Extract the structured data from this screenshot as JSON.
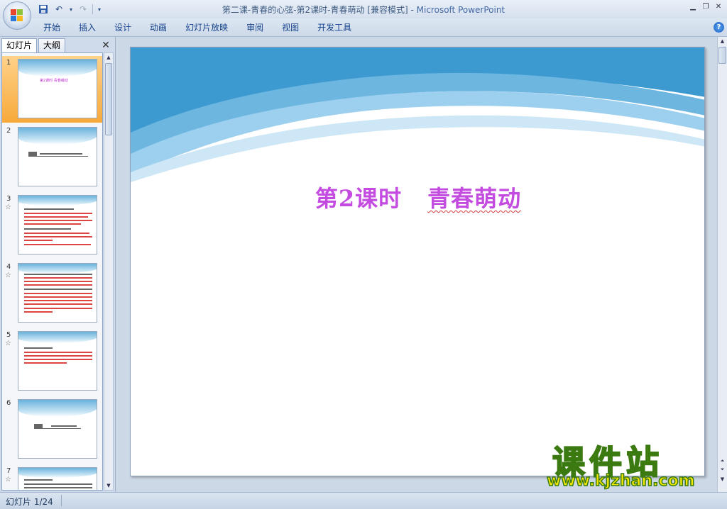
{
  "window": {
    "title": "第二课-青春的心弦-第2课时-青春萌动 [兼容模式]",
    "app_name": "Microsoft PowerPoint",
    "title_sep": " - "
  },
  "ribbon": {
    "tabs": [
      "开始",
      "插入",
      "设计",
      "动画",
      "幻灯片放映",
      "审阅",
      "视图",
      "开发工具"
    ]
  },
  "left_pane": {
    "tab_slides": "幻灯片",
    "tab_outline": "大纲",
    "slides": [
      {
        "num": "1",
        "selected": true,
        "title": "第2课时  青春萌动"
      },
      {
        "num": "2",
        "selected": false,
        "title": ""
      },
      {
        "num": "3",
        "selected": false,
        "title": ""
      },
      {
        "num": "4",
        "selected": false,
        "title": ""
      },
      {
        "num": "5",
        "selected": false,
        "title": ""
      },
      {
        "num": "6",
        "selected": false,
        "title": ""
      },
      {
        "num": "7",
        "selected": false,
        "title": ""
      }
    ]
  },
  "slide": {
    "title_left": "第2课时",
    "title_right": "青春萌动",
    "colors": {
      "title": "#c44be0",
      "wave_dark": "#4aa3d4",
      "wave_light": "#bfe2f3"
    }
  },
  "status": {
    "slide_indicator": "幻灯片 1/24"
  },
  "watermark": {
    "brand": "课件站",
    "url": "www.kjzhan.com"
  }
}
